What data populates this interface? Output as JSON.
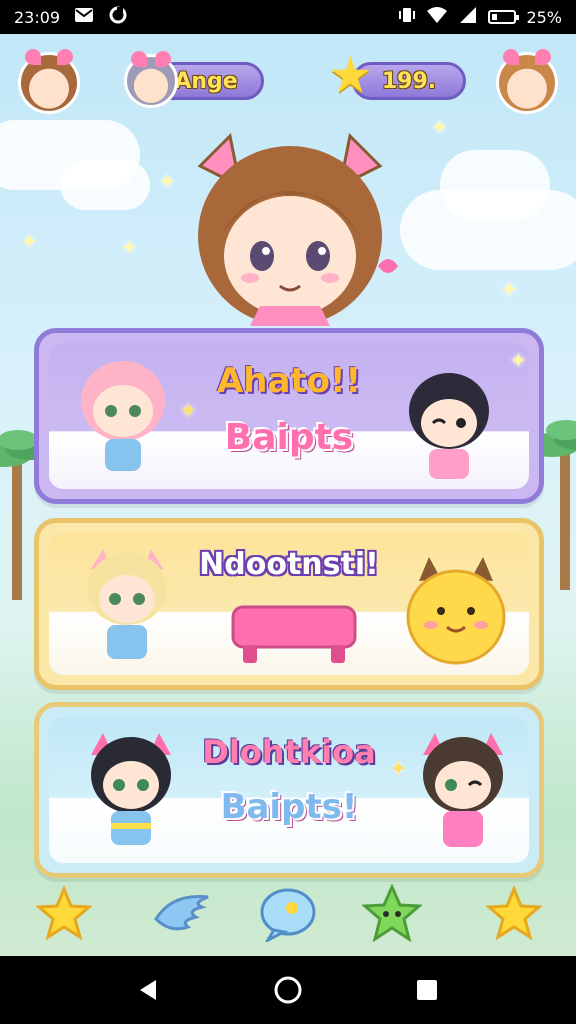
{
  "status_bar": {
    "time": "23:09",
    "battery_text": "25%",
    "battery_level": 0.25
  },
  "top_bar": {
    "player_name": "Ange",
    "coins": "199."
  },
  "cards": [
    {
      "title": "Ahato!!",
      "subtitle": "Baipts",
      "bg": "#cbb8f2",
      "border": "#8f7bd8"
    },
    {
      "title": "Ndootnsti!",
      "subtitle": "",
      "bg": "#fbe7a8",
      "border": "#e9c36a"
    },
    {
      "title": "Dlohtkioa",
      "subtitle": "Baipts!",
      "bg": "#c9ecf7",
      "border": "#e7c977"
    }
  ],
  "colors": {
    "accent_pink": "#ff6fae",
    "accent_purple": "#8e79d8",
    "accent_yellow": "#ffd83a"
  },
  "toolbar": {
    "icons": [
      "star-icon",
      "wing-icon",
      "chat-bubble-icon",
      "star-face-icon",
      "star-icon"
    ]
  },
  "navbar": {
    "icons": [
      "back-icon",
      "home-icon",
      "recents-icon"
    ]
  }
}
